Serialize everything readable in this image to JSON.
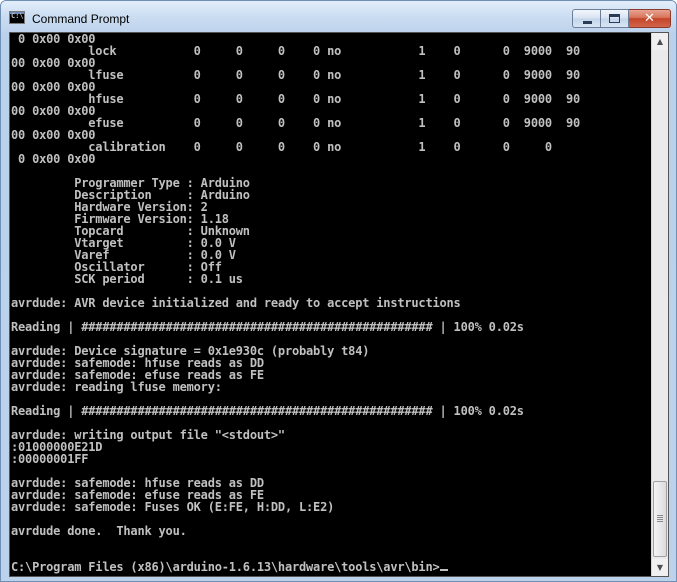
{
  "window": {
    "title": "Command Prompt",
    "app_icon_text": "C:\\",
    "buttons": {
      "minimize": "minimize",
      "maximize": "maximize",
      "close": "✕"
    }
  },
  "console": {
    "lines": [
      " 0 0x00 0x00",
      "           lock           0     0     0    0 no           1    0      0  9000  90",
      "00 0x00 0x00",
      "           lfuse          0     0     0    0 no           1    0      0  9000  90",
      "00 0x00 0x00",
      "           hfuse          0     0     0    0 no           1    0      0  9000  90",
      "00 0x00 0x00",
      "           efuse          0     0     0    0 no           1    0      0  9000  90",
      "00 0x00 0x00",
      "           calibration    0     0     0    0 no           1    0      0     0",
      " 0 0x00 0x00",
      "",
      "         Programmer Type : Arduino",
      "         Description     : Arduino",
      "         Hardware Version: 2",
      "         Firmware Version: 1.18",
      "         Topcard         : Unknown",
      "         Vtarget         : 0.0 V",
      "         Varef           : 0.0 V",
      "         Oscillator      : Off",
      "         SCK period      : 0.1 us",
      "",
      "avrdude: AVR device initialized and ready to accept instructions",
      "",
      "Reading | ################################################## | 100% 0.02s",
      "",
      "avrdude: Device signature = 0x1e930c (probably t84)",
      "avrdude: safemode: hfuse reads as DD",
      "avrdude: safemode: efuse reads as FE",
      "avrdude: reading lfuse memory:",
      "",
      "Reading | ################################################## | 100% 0.02s",
      "",
      "avrdude: writing output file \"<stdout>\"",
      ":01000000E21D",
      ":00000001FF",
      "",
      "avrdude: safemode: hfuse reads as DD",
      "avrdude: safemode: efuse reads as FE",
      "avrdude: safemode: Fuses OK (E:FE, H:DD, L:E2)",
      "",
      "avrdude done.  Thank you.",
      "",
      ""
    ],
    "prompt": "C:\\Program Files (x86)\\arduino-1.6.13\\hardware\\tools\\avr\\bin>"
  },
  "scrollbar": {
    "up_arrow": "▲",
    "down_arrow": "▼",
    "position_fraction": 0.95
  },
  "colors": {
    "console_background": "#000000",
    "console_text": "#c0c0c0",
    "titlebar": "#bdd3ec",
    "close_button": "#c5452a"
  }
}
